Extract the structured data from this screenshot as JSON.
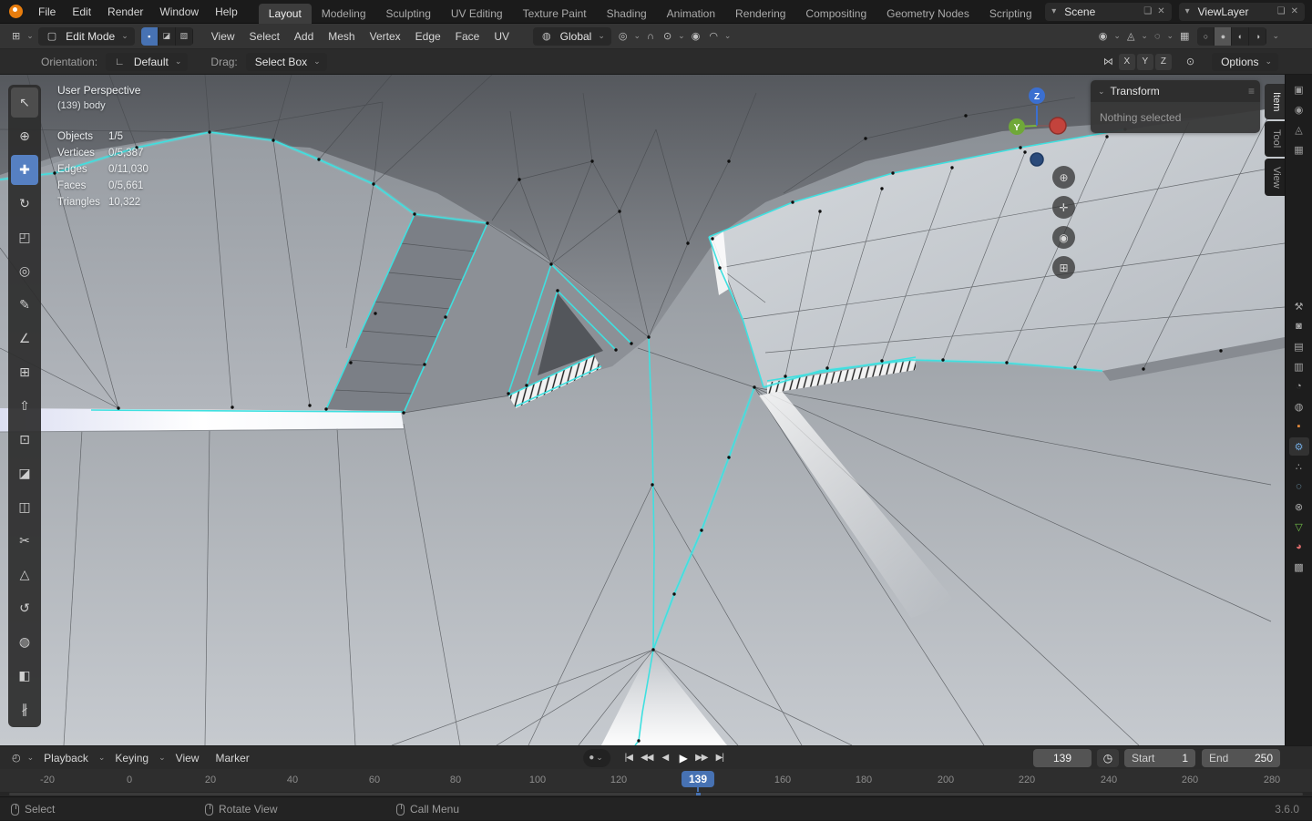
{
  "colors": {
    "accent_blue": "#4772b3",
    "selection_cyan": "#3fe0e0",
    "active_tool_blue": "#5680c2",
    "object_orange": "#e0883c",
    "modifier_blue": "#71a8dd",
    "data_green": "#74c04a",
    "material_red": "#d96a6a"
  },
  "topbar": {
    "app_menus": [
      "File",
      "Edit",
      "Render",
      "Window",
      "Help"
    ],
    "workspaces": [
      "Layout",
      "Modeling",
      "Sculpting",
      "UV Editing",
      "Texture Paint",
      "Shading",
      "Animation",
      "Rendering",
      "Compositing",
      "Geometry Nodes",
      "Scripting"
    ],
    "scene": {
      "icon": "▾",
      "label": "Scene",
      "copy_icon": "❏",
      "close_icon": "✕"
    },
    "view_layer": {
      "icon": "▾",
      "label": "ViewLayer",
      "copy_icon": "❏",
      "close_icon": "✕"
    }
  },
  "viewport_header": {
    "editor_icon": "⊞",
    "mode": {
      "icon": "▢",
      "label": "Edit Mode"
    },
    "select_modes": [
      {
        "name": "vertex-select",
        "glyph": "▪"
      },
      {
        "name": "edge-select",
        "glyph": "◪"
      },
      {
        "name": "face-select",
        "glyph": "▧"
      }
    ],
    "menus": [
      "View",
      "Select",
      "Add",
      "Mesh",
      "Vertex",
      "Edge",
      "Face",
      "UV"
    ],
    "orientation": {
      "icon": "◍",
      "label": "Global"
    },
    "pivot_icon": "◎",
    "snap_icon": "∩",
    "snap_target_icon": "⊙",
    "proportional_icon": "◉",
    "falloff_icon": "◠",
    "visibility_icon": "◉",
    "gizmo_icon": "◬",
    "overlays_icon": "◌",
    "xray_icon": "▦",
    "shading_modes": [
      {
        "name": "wireframe-shading",
        "glyph": "○"
      },
      {
        "name": "solid-shading",
        "glyph": "●"
      },
      {
        "name": "material-shading",
        "glyph": "◐"
      },
      {
        "name": "rendered-shading",
        "glyph": "◑"
      }
    ]
  },
  "tool_settings": {
    "orientation_label": "Orientation:",
    "orientation_icon": "∟",
    "orientation_value": "Default",
    "drag_label": "Drag:",
    "drag_value": "Select Box",
    "mirror_icon": "⋈",
    "axes": [
      "X",
      "Y",
      "Z"
    ],
    "snap_base_icon": "⊙",
    "options_label": "Options"
  },
  "toolbar": {
    "tools": [
      {
        "name": "select-box",
        "glyph": "↖"
      },
      {
        "name": "cursor",
        "glyph": "⊕"
      },
      {
        "name": "move",
        "glyph": "✚"
      },
      {
        "name": "rotate",
        "glyph": "↻"
      },
      {
        "name": "scale",
        "glyph": "◰"
      },
      {
        "name": "transform",
        "glyph": "◎"
      },
      {
        "name": "annotate",
        "glyph": "✎"
      },
      {
        "name": "measure",
        "glyph": "∠"
      },
      {
        "name": "add-cube",
        "glyph": "⊞"
      },
      {
        "name": "extrude-region",
        "glyph": "⇧"
      },
      {
        "name": "inset-faces",
        "glyph": "⊡"
      },
      {
        "name": "bevel",
        "glyph": "◪"
      },
      {
        "name": "loop-cut",
        "glyph": "◫"
      },
      {
        "name": "knife",
        "glyph": "✂"
      },
      {
        "name": "poly-build",
        "glyph": "△"
      },
      {
        "name": "spin",
        "glyph": "↺"
      },
      {
        "name": "smooth",
        "glyph": "◍"
      },
      {
        "name": "edge-slide",
        "glyph": "◧"
      },
      {
        "name": "rip-region",
        "glyph": "∦"
      }
    ]
  },
  "viewport": {
    "overlay": {
      "perspective": "User Perspective",
      "object_info": "(139) body",
      "stats": [
        {
          "label": "Objects",
          "value": "1/5"
        },
        {
          "label": "Vertices",
          "value": "0/5,387"
        },
        {
          "label": "Edges",
          "value": "0/11,030"
        },
        {
          "label": "Faces",
          "value": "0/5,661"
        },
        {
          "label": "Triangles",
          "value": "10,322"
        }
      ]
    },
    "axis_gizmo": {
      "z_label": "Z",
      "y_label": "Y"
    },
    "nav_buttons": [
      {
        "name": "zoom-icon",
        "glyph": "⊕"
      },
      {
        "name": "pan-icon",
        "glyph": "✛"
      },
      {
        "name": "camera-view-icon",
        "glyph": "◉"
      },
      {
        "name": "perspective-icon",
        "glyph": "⊞"
      }
    ],
    "sidebar_tabs": [
      "Item",
      "Tool",
      "View"
    ],
    "transform_panel": {
      "collapse_icon": "⌄",
      "title": "Transform",
      "menu_icon": "≡",
      "message": "Nothing selected"
    }
  },
  "props_rail": {
    "outliner_icons": [
      {
        "name": "outliner-icon-1",
        "glyph": "▣"
      },
      {
        "name": "outliner-icon-2",
        "glyph": "◉"
      },
      {
        "name": "outliner-icon-3",
        "glyph": "◬"
      },
      {
        "name": "outliner-icon-4",
        "glyph": "▦"
      }
    ],
    "tabs": [
      {
        "name": "tab-active-tool",
        "glyph": "⚒",
        "color": "#a8a8a8"
      },
      {
        "name": "tab-render",
        "glyph": "◙",
        "color": "#a8a8a8"
      },
      {
        "name": "tab-output",
        "glyph": "▤",
        "color": "#a8a8a8"
      },
      {
        "name": "tab-view-layer",
        "glyph": "▥",
        "color": "#a8a8a8"
      },
      {
        "name": "tab-scene",
        "glyph": "◔",
        "color": "#a8a8a8"
      },
      {
        "name": "tab-world",
        "glyph": "◍",
        "color": "#a8a8a8"
      },
      {
        "name": "tab-object",
        "glyph": "▪",
        "color": "#e0883c"
      },
      {
        "name": "tab-modifiers",
        "glyph": "⚙",
        "color": "#71a8dd"
      },
      {
        "name": "tab-particles",
        "glyph": "∴",
        "color": "#a8a8a8"
      },
      {
        "name": "tab-physics",
        "glyph": "◌",
        "color": "#8fc8e8"
      },
      {
        "name": "tab-constraints",
        "glyph": "⊗",
        "color": "#a8a8a8"
      },
      {
        "name": "tab-object-data",
        "glyph": "▽",
        "color": "#74c04a"
      },
      {
        "name": "tab-material",
        "glyph": "◕",
        "color": "#d96a6a"
      },
      {
        "name": "tab-texture",
        "glyph": "▩",
        "color": "#a8a8a8"
      }
    ]
  },
  "timeline": {
    "editor_icon": "◴",
    "menus": [
      "Playback",
      "Keying",
      "View",
      "Marker"
    ],
    "autokey_icon": "●",
    "transport": [
      {
        "name": "jump-to-start-icon",
        "glyph": "|◀"
      },
      {
        "name": "prev-keyframe-icon",
        "glyph": "◀◀"
      },
      {
        "name": "play-reverse-icon",
        "glyph": "◀"
      },
      {
        "name": "play-icon",
        "glyph": "▶"
      },
      {
        "name": "next-keyframe-icon",
        "glyph": "▶▶"
      },
      {
        "name": "jump-to-end-icon",
        "glyph": "▶|"
      }
    ],
    "current_frame": "139",
    "clock_icon": "◷",
    "start_label": "Start",
    "start_value": "1",
    "end_label": "End",
    "end_value": "250",
    "ticks": [
      "-20",
      "0",
      "20",
      "40",
      "60",
      "80",
      "100",
      "120",
      "160",
      "180",
      "200",
      "220",
      "240",
      "260",
      "280"
    ]
  },
  "status_bar": {
    "hints": [
      "Select",
      "Rotate View",
      "Call Menu"
    ],
    "version": "3.6.0"
  }
}
